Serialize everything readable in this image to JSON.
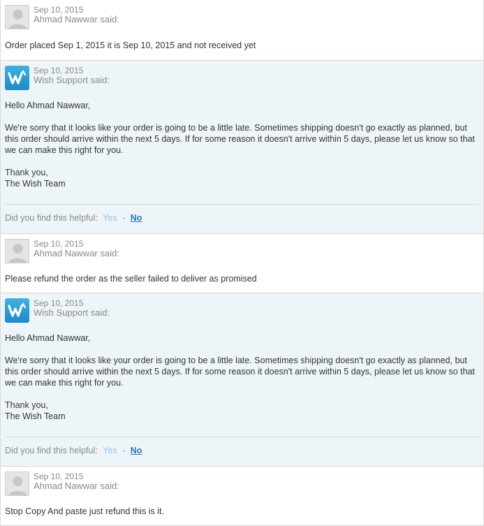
{
  "messages": [
    {
      "kind": "user",
      "date": "Sep 10, 2015",
      "author": "Ahmad Nawwar said:",
      "paragraphs": [
        "Order placed Sep 1, 2015 it is Sep 10, 2015 and not received yet"
      ]
    },
    {
      "kind": "support",
      "date": "Sep 10, 2015",
      "author": "Wish Support said:",
      "greeting": "Hello Ahmad Nawwar,",
      "body": "We're sorry that it looks like your order is going to be a little late. Sometimes shipping doesn't go exactly as planned, but this order should arrive within the next 5 days. If for some reason it doesn't arrive within 5 days, please let us know so that we can make this right for you.",
      "signoff_1": "Thank you,",
      "signoff_2": "The Wish Team",
      "helpful_prompt": "Did you find this helpful:",
      "yes_label": "Yes",
      "separator": "-",
      "no_label": "No"
    },
    {
      "kind": "user",
      "date": "Sep 10, 2015",
      "author": "Ahmad Nawwar said:",
      "paragraphs": [
        "Please refund the order as the seller failed to deliver as promised"
      ]
    },
    {
      "kind": "support",
      "date": "Sep 10, 2015",
      "author": "Wish Support said:",
      "greeting": "Hello Ahmad Nawwar,",
      "body": "We're sorry that it looks like your order is going to be a little late. Sometimes shipping doesn't go exactly as planned, but this order should arrive within the next 5 days. If for some reason it doesn't arrive within 5 days, please let us know so that we can make this right for you.",
      "signoff_1": "Thank you,",
      "signoff_2": "The Wish Team",
      "helpful_prompt": "Did you find this helpful:",
      "yes_label": "Yes",
      "separator": "-",
      "no_label": "No"
    },
    {
      "kind": "user",
      "date": "Sep 10, 2015",
      "author": "Ahmad Nawwar said:",
      "paragraphs": [
        "Stop Copy And paste just refund this is it."
      ]
    }
  ],
  "icons": {
    "user_avatar": "default-user-avatar-icon",
    "support_avatar": "wish-logo-icon"
  },
  "colors": {
    "support_bg": "#eef5f9",
    "link_yes": "#8fc4e0",
    "link_no": "#2a79b4",
    "wish_brand": "#2aa0d8"
  }
}
